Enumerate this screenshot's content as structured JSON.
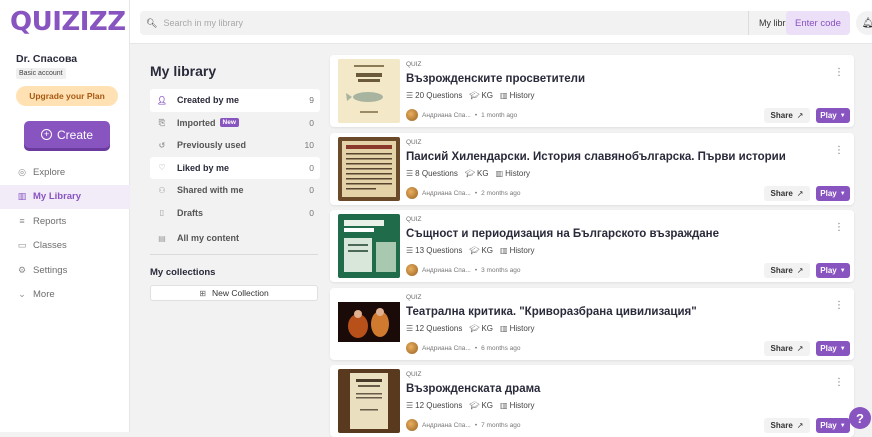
{
  "brand": {
    "logo": "QUIZIZZ",
    "accent": "#8854c0"
  },
  "user": {
    "name": "Dr. Спасова",
    "account": "Basic account"
  },
  "sidebar": {
    "upgrade_label": "Upgrade your Plan",
    "create_label": "Create",
    "items": [
      {
        "label": "Explore",
        "icon": "compass-icon"
      },
      {
        "label": "My Library",
        "icon": "library-icon"
      },
      {
        "label": "Reports",
        "icon": "chart-icon"
      },
      {
        "label": "Classes",
        "icon": "classes-icon"
      },
      {
        "label": "Settings",
        "icon": "gear-icon"
      },
      {
        "label": "More",
        "icon": "chevron-down-icon"
      }
    ]
  },
  "search": {
    "placeholder": "Search in my library",
    "scope": "My library"
  },
  "header": {
    "enter_code": "Enter code"
  },
  "library": {
    "title": "My library",
    "filters": [
      {
        "label": "Created by me",
        "count": "9"
      },
      {
        "label": "Imported",
        "badge": "New",
        "count": "0"
      },
      {
        "label": "Previously used",
        "count": "10"
      },
      {
        "label": "Liked by me",
        "count": "0"
      },
      {
        "label": "Shared with me",
        "count": "0"
      },
      {
        "label": "Drafts",
        "count": "0"
      },
      {
        "label": "All my content",
        "count": ""
      }
    ],
    "collections_title": "My collections",
    "new_collection": "New Collection"
  },
  "quizzes": [
    {
      "kind": "QUIZ",
      "title": "Възрожденските просветители",
      "questions": "20 Questions",
      "grade": "KG",
      "subject": "History",
      "author": "Андриана Спа...",
      "time": "1 month ago"
    },
    {
      "kind": "QUIZ",
      "title": "Паисий Хилендарски. История славянобългарска. Първи истории",
      "questions": "8 Questions",
      "grade": "KG",
      "subject": "History",
      "author": "Андриана Спа...",
      "time": "2 months ago"
    },
    {
      "kind": "QUIZ",
      "title": "Същност и периодизация на Българското възраждане",
      "questions": "13 Questions",
      "grade": "KG",
      "subject": "History",
      "author": "Андриана Спа...",
      "time": "3 months ago"
    },
    {
      "kind": "QUIZ",
      "title": "Театрална критика. \"Криворазбрана цивилизация\"",
      "questions": "12 Questions",
      "grade": "KG",
      "subject": "History",
      "author": "Андриана Спа...",
      "time": "6 months ago"
    },
    {
      "kind": "QUIZ",
      "title": "Възрожденската драма",
      "questions": "12 Questions",
      "grade": "KG",
      "subject": "History",
      "author": "Андриана Спа...",
      "time": "7 months ago"
    }
  ],
  "card_actions": {
    "share": "Share",
    "play": "Play"
  }
}
